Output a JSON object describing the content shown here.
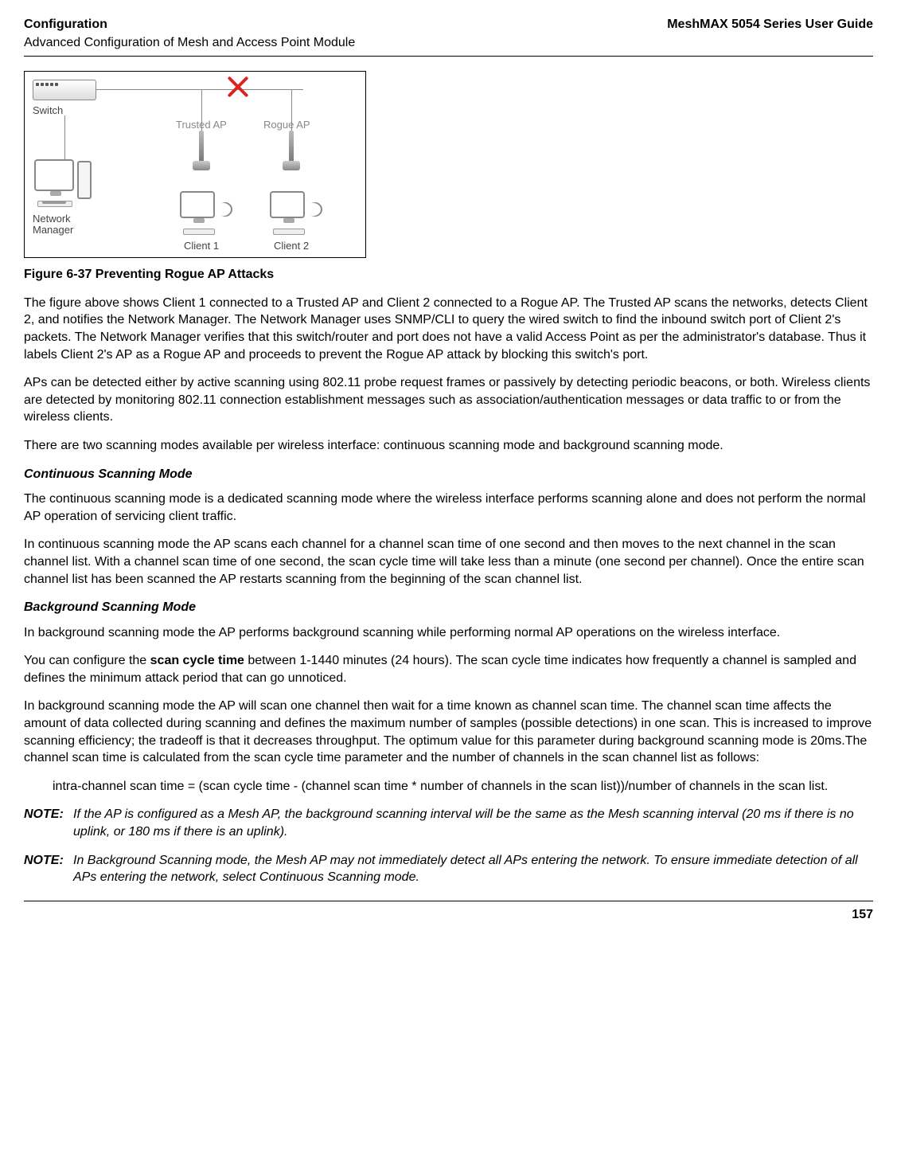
{
  "header": {
    "left_top": "Configuration",
    "left_sub": "Advanced Configuration of Mesh and Access Point Module",
    "right": "MeshMAX 5054 Series User Guide"
  },
  "diagram": {
    "switch_label": "Switch",
    "trusted_ap_label": "Trusted AP",
    "rogue_ap_label": "Rogue AP",
    "network_manager_label_1": "Network",
    "network_manager_label_2": "Manager",
    "client1_label": "Client 1",
    "client2_label": "Client 2"
  },
  "figure_caption": "Figure 6-37 Preventing Rogue AP Attacks",
  "para1": "The figure above shows Client 1 connected to a Trusted AP and Client 2 connected to a Rogue AP. The Trusted AP scans the networks, detects Client 2, and notifies the Network Manager. The Network Manager uses SNMP/CLI to query the wired switch to find the inbound switch port of Client 2's packets. The Network Manager verifies that this switch/router and port does not have a valid Access Point as per the administrator's database. Thus it labels Client 2's AP as a Rogue AP and proceeds to prevent the Rogue AP attack by blocking this switch's port.",
  "para2": "APs can be detected either by active scanning using 802.11 probe request frames or passively by detecting periodic beacons, or both. Wireless clients are detected by monitoring 802.11 connection establishment messages such as association/authentication messages or data traffic to or from the wireless clients.",
  "para3": "There are two scanning modes available per wireless interface: continuous scanning mode and background scanning mode.",
  "continuous": {
    "heading": "Continuous Scanning Mode",
    "p1": "The continuous scanning mode is a dedicated scanning mode where the wireless interface performs scanning alone and does not perform the normal AP operation of servicing client traffic.",
    "p2": "In continuous scanning mode the AP scans each channel for a channel scan time of one second and then moves to the next channel in the scan channel list. With a channel scan time of one second, the scan cycle time will take less than a minute (one second per channel). Once the entire scan channel list has been scanned the AP restarts scanning from the beginning of the scan channel list."
  },
  "background": {
    "heading": "Background Scanning Mode",
    "p1": "In background scanning mode the AP performs background scanning while performing normal AP operations on the wireless interface.",
    "p2_pre": "You can configure the ",
    "p2_bold": "scan cycle time",
    "p2_post": " between 1-1440 minutes (24 hours). The scan cycle time indicates how frequently a channel is sampled and defines the minimum attack period that can go unnoticed.",
    "p3": "In background scanning mode the AP will scan one channel then wait for a time known as channel scan time. The channel scan time affects the amount of data collected during scanning and defines the maximum number of samples (possible detections) in one scan. This is increased to improve scanning efficiency; the tradeoff is that it decreases throughput. The optimum value for this parameter during background scanning mode is 20ms.The channel scan time is calculated from the scan cycle time parameter and the number of channels in the scan channel list as follows:",
    "formula": "intra-channel scan time = (scan cycle time - (channel scan time * number of channels in the scan list))/number of channels in the scan list."
  },
  "notes": {
    "label": "NOTE:",
    "n1": "If the AP is configured as a Mesh AP, the background scanning interval will be the same as the Mesh scanning interval (20 ms if there is no uplink, or 180 ms if there is an uplink).",
    "n2": "In Background Scanning mode, the Mesh AP may not immediately detect all APs entering the network. To ensure immediate detection of all APs entering the network, select Continuous Scanning mode."
  },
  "page_number": "157",
  "chart_data": {
    "type": "diagram",
    "title": "Preventing Rogue AP Attacks",
    "nodes": [
      {
        "id": "switch",
        "label": "Switch",
        "type": "network-switch"
      },
      {
        "id": "network_manager",
        "label": "Network Manager",
        "type": "computer"
      },
      {
        "id": "trusted_ap",
        "label": "Trusted AP",
        "type": "access-point"
      },
      {
        "id": "rogue_ap",
        "label": "Rogue AP",
        "type": "access-point"
      },
      {
        "id": "client1",
        "label": "Client 1",
        "type": "wireless-client"
      },
      {
        "id": "client2",
        "label": "Client 2",
        "type": "wireless-client"
      }
    ],
    "edges": [
      {
        "from": "switch",
        "to": "network_manager",
        "type": "wired"
      },
      {
        "from": "switch",
        "to": "trusted_ap",
        "type": "wired"
      },
      {
        "from": "switch",
        "to": "rogue_ap",
        "type": "wired",
        "blocked": true
      },
      {
        "from": "trusted_ap",
        "to": "client1",
        "type": "wireless"
      },
      {
        "from": "rogue_ap",
        "to": "client2",
        "type": "wireless"
      }
    ]
  }
}
